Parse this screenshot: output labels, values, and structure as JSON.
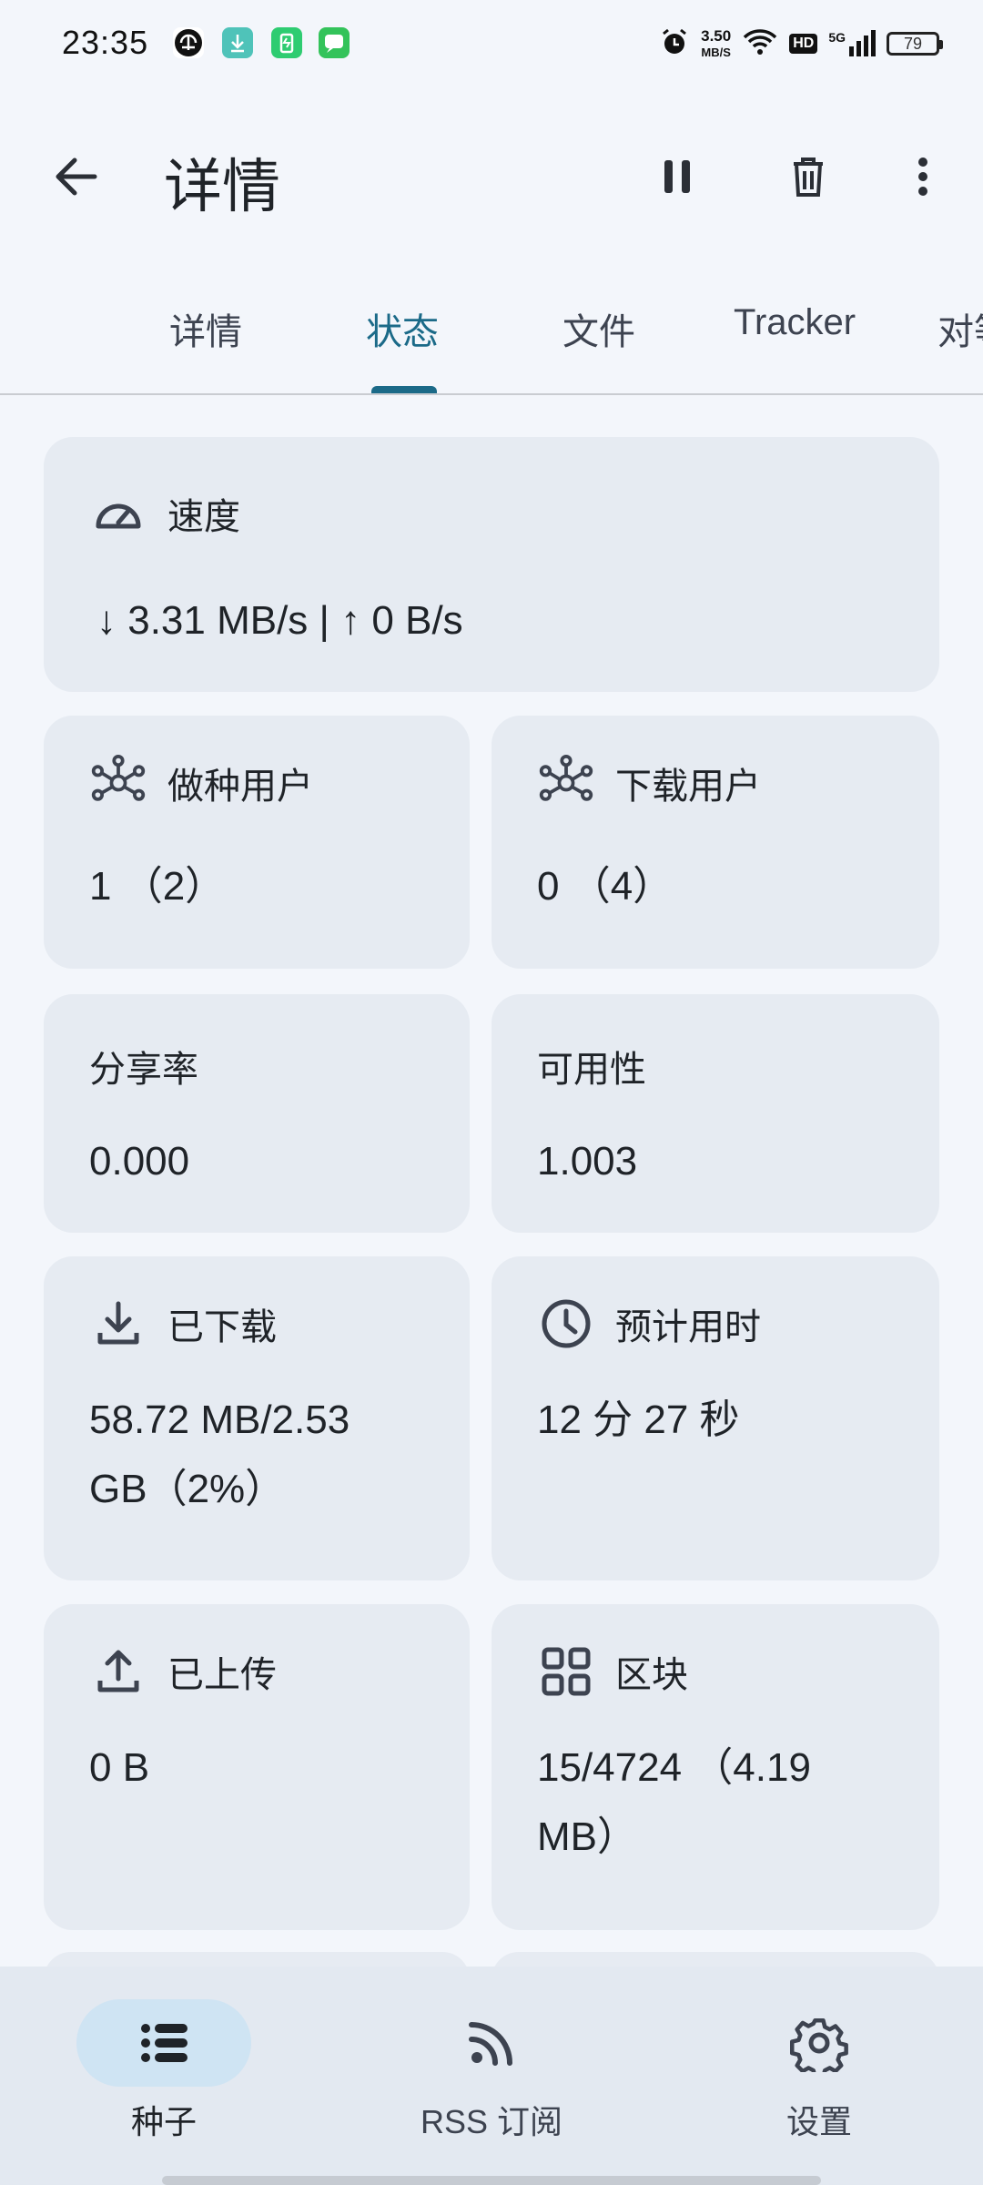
{
  "status_bar": {
    "time": "23:35",
    "net_speed_value": "3.50",
    "net_speed_unit": "MB/S",
    "hd": "HD",
    "network": "5G",
    "battery": "79"
  },
  "top_bar": {
    "title": "详情"
  },
  "tabs": [
    {
      "label": "详情"
    },
    {
      "label": "状态"
    },
    {
      "label": "文件"
    },
    {
      "label": "Tracker"
    },
    {
      "label": "对等"
    }
  ],
  "cards": {
    "speed": {
      "label": "速度",
      "value": "↓ 3.31 MB/s | ↑ 0 B/s"
    },
    "seeds": {
      "label": "做种用户",
      "value": "1 （2）"
    },
    "peers": {
      "label": "下载用户",
      "value": "0 （4）"
    },
    "ratio": {
      "label": "分享率",
      "value": "0.000"
    },
    "availability": {
      "label": "可用性",
      "value": "1.003"
    },
    "downloaded": {
      "label": "已下载",
      "value_line1": "58.72 MB/2.53",
      "value_line2": "GB（2%）"
    },
    "eta": {
      "label": "预计用时",
      "value": "12 分 27 秒"
    },
    "uploaded": {
      "label": "已上传",
      "value": "0 B"
    },
    "pieces": {
      "label": "区块",
      "value_line1": "15/4724 （4.19",
      "value_line2": "MB）"
    }
  },
  "bottom_nav": [
    {
      "label": "种子"
    },
    {
      "label": "RSS 订阅"
    },
    {
      "label": "设置"
    }
  ]
}
